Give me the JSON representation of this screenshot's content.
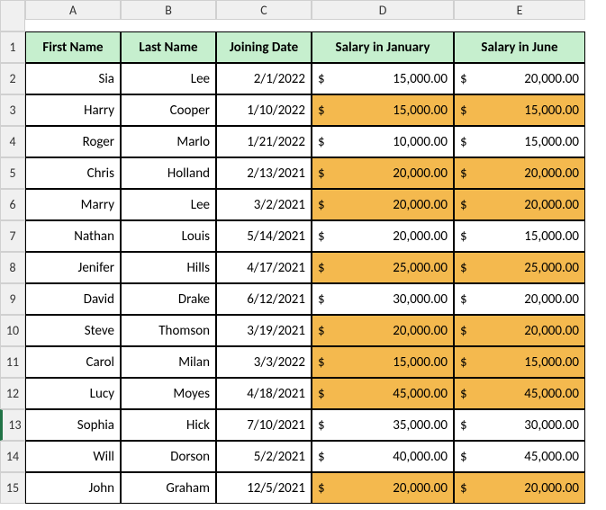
{
  "columns": [
    "A",
    "B",
    "C",
    "D",
    "E"
  ],
  "headers": {
    "firstname": "First Name",
    "lastname": "Last Name",
    "joindate": "Joining Date",
    "saljan": "Salary in January",
    "saljun": "Salary in June"
  },
  "rows": [
    {
      "n": "2",
      "first": "Sia",
      "last": "Lee",
      "date": "2/1/2022",
      "jan": "15,000.00",
      "jun": "20,000.00",
      "hl": false
    },
    {
      "n": "3",
      "first": "Harry",
      "last": "Cooper",
      "date": "1/10/2022",
      "jan": "15,000.00",
      "jun": "15,000.00",
      "hl": true
    },
    {
      "n": "4",
      "first": "Roger",
      "last": "Marlo",
      "date": "1/21/2022",
      "jan": "10,000.00",
      "jun": "15,000.00",
      "hl": false
    },
    {
      "n": "5",
      "first": "Chris",
      "last": "Holland",
      "date": "2/13/2021",
      "jan": "20,000.00",
      "jun": "20,000.00",
      "hl": true
    },
    {
      "n": "6",
      "first": "Marry",
      "last": "Lee",
      "date": "3/2/2021",
      "jan": "20,000.00",
      "jun": "20,000.00",
      "hl": true
    },
    {
      "n": "7",
      "first": "Nathan",
      "last": "Louis",
      "date": "5/14/2021",
      "jan": "20,000.00",
      "jun": "15,000.00",
      "hl": false
    },
    {
      "n": "8",
      "first": "Jenifer",
      "last": "Hills",
      "date": "4/17/2021",
      "jan": "25,000.00",
      "jun": "25,000.00",
      "hl": true
    },
    {
      "n": "9",
      "first": "David",
      "last": "Drake",
      "date": "6/12/2021",
      "jan": "30,000.00",
      "jun": "20,000.00",
      "hl": false
    },
    {
      "n": "10",
      "first": "Steve",
      "last": "Thomson",
      "date": "3/19/2021",
      "jan": "20,000.00",
      "jun": "20,000.00",
      "hl": true
    },
    {
      "n": "11",
      "first": "Carol",
      "last": "Milan",
      "date": "3/3/2022",
      "jan": "15,000.00",
      "jun": "15,000.00",
      "hl": true
    },
    {
      "n": "12",
      "first": "Lucy",
      "last": "Moyes",
      "date": "4/18/2021",
      "jan": "45,000.00",
      "jun": "45,000.00",
      "hl": true
    },
    {
      "n": "13",
      "first": "Sophia",
      "last": "Hick",
      "date": "7/10/2021",
      "jan": "35,000.00",
      "jun": "30,000.00",
      "hl": false,
      "sel": true
    },
    {
      "n": "14",
      "first": "Will",
      "last": "Dorson",
      "date": "5/2/2021",
      "jan": "40,000.00",
      "jun": "45,000.00",
      "hl": false
    },
    {
      "n": "15",
      "first": "John",
      "last": "Graham",
      "date": "12/5/2021",
      "jan": "20,000.00",
      "jun": "20,000.00",
      "hl": true
    }
  ],
  "currency": "$"
}
